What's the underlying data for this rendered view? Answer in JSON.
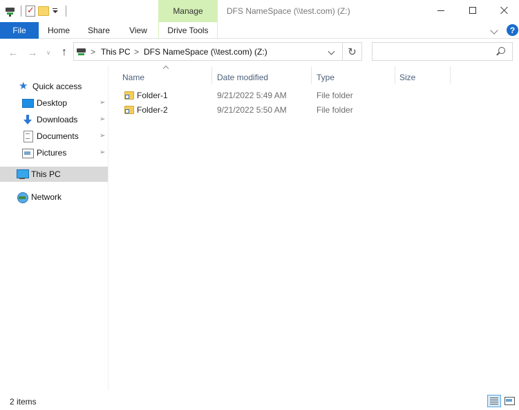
{
  "window": {
    "title": "DFS NameSpace (\\\\test.com) (Z:)",
    "context_tab_group": "Manage"
  },
  "ribbon": {
    "tabs": [
      "File",
      "Home",
      "Share",
      "View",
      "Drive Tools"
    ],
    "accent": "#1a6dcc",
    "context_color": "#d5f0b7",
    "help_label": "?"
  },
  "nav": {
    "back_icon": "arrow-left-icon",
    "forward_icon": "arrow-right-icon",
    "up_icon": "arrow-up-icon"
  },
  "address": {
    "segments": [
      "This PC",
      "DFS NameSpace (\\\\test.com) (Z:)"
    ],
    "separator": ">"
  },
  "search": {
    "value": "",
    "placeholder": ""
  },
  "sidebar": {
    "quick_access": "Quick access",
    "pinned": [
      {
        "label": "Desktop",
        "icon": "desktop-icon"
      },
      {
        "label": "Downloads",
        "icon": "downloads-icon"
      },
      {
        "label": "Documents",
        "icon": "documents-icon"
      },
      {
        "label": "Pictures",
        "icon": "pictures-icon"
      }
    ],
    "this_pc": "This PC",
    "network": "Network"
  },
  "filelist": {
    "columns": [
      "Name",
      "Date modified",
      "Type",
      "Size"
    ],
    "rows": [
      {
        "name": "Folder-1",
        "date": "9/21/2022 5:49 AM",
        "type": "File folder"
      },
      {
        "name": "Folder-2",
        "date": "9/21/2022 5:50 AM",
        "type": "File folder"
      }
    ]
  },
  "status": {
    "item_count": "2 items"
  }
}
